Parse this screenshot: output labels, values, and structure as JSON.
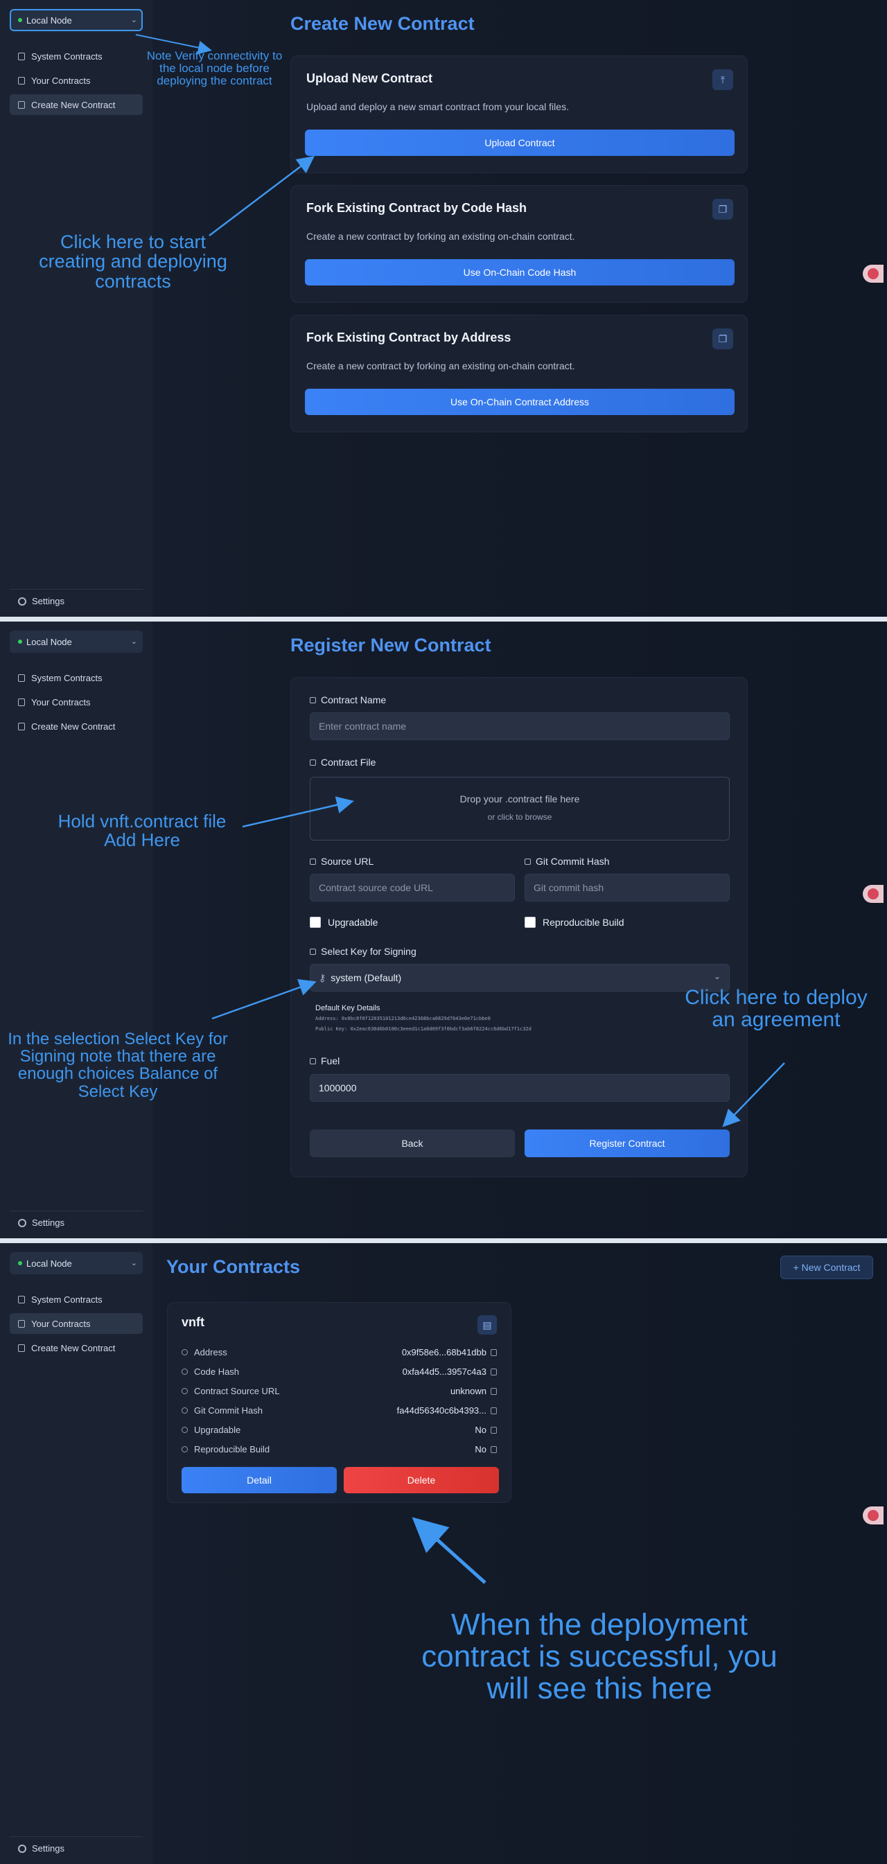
{
  "sidebar": {
    "node_label": "Local Node",
    "items": [
      "System Contracts",
      "Your Contracts",
      "Create New Contract"
    ],
    "settings_label": "Settings"
  },
  "create": {
    "title": "Create New Contract",
    "cards": [
      {
        "title": "Upload New Contract",
        "desc": "Upload and deploy a new smart contract from your local files.",
        "button": "Upload Contract",
        "icon": "upload-icon"
      },
      {
        "title": "Fork Existing Contract by Code Hash",
        "desc": "Create a new contract by forking an existing on-chain contract.",
        "button": "Use On-Chain Code Hash",
        "icon": "copy-icon"
      },
      {
        "title": "Fork Existing Contract by Address",
        "desc": "Create a new contract by forking an existing on-chain contract.",
        "button": "Use On-Chain Contract Address",
        "icon": "copy-icon"
      }
    ]
  },
  "register": {
    "title": "Register New Contract",
    "contract_name_label": "Contract Name",
    "contract_name_placeholder": "Enter contract name",
    "contract_file_label": "Contract File",
    "drop_main": "Drop your .contract file here",
    "drop_sub": "or click to browse",
    "source_url_label": "Source URL",
    "source_url_placeholder": "Contract source code URL",
    "git_label": "Git Commit Hash",
    "git_placeholder": "Git commit hash",
    "upgradable_label": "Upgradable",
    "reproducible_label": "Reproducible Build",
    "key_label": "Select Key for Signing",
    "key_value": "system (Default)",
    "key_details_title": "Default Key Details",
    "key_address": "Address: 0x0bc8f0f12035101213d6ce42368bca0829d7643e0e71cbbe0",
    "key_public": "Public Key: 0x2eac630d6b0100c3eeed1c1a0d69f3f0bdcf3ab6f8224cc6d6bd17f1c32d",
    "fuel_label": "Fuel",
    "fuel_value": "1000000",
    "back_label": "Back",
    "submit_label": "Register Contract"
  },
  "yours": {
    "title": "Your Contracts",
    "new_button": "+ New Contract",
    "contract": {
      "name": "vnft",
      "rows": [
        {
          "label": "Address",
          "value": "0x9f58e6...68b41dbb"
        },
        {
          "label": "Code Hash",
          "value": "0xfa44d5...3957c4a3"
        },
        {
          "label": "Contract Source URL",
          "value": "unknown"
        },
        {
          "label": "Git Commit Hash",
          "value": "fa44d56340c6b4393..."
        },
        {
          "label": "Upgradable",
          "value": "No"
        },
        {
          "label": "Reproducible Build",
          "value": "No"
        }
      ],
      "detail_button": "Detail",
      "delete_button": "Delete"
    }
  },
  "annotations": {
    "verify_note": "Note Verify connectivity to the local node before deploying the contract",
    "click_here": "Click here to start creating and deploying contracts",
    "hold_file": "Hold vnft.contract file Add Here",
    "select_key_note": "In the selection Select Key for Signing note that there are enough choices Balance of Select Key",
    "deploy_note": "Click here to deploy an agreement",
    "success_note": "When the deployment contract is successful, you will see this here"
  },
  "colors": {
    "accent": "#3b82f6",
    "title_blue": "#4f94f0",
    "annotation_blue": "#3f97ef",
    "danger": "#ef4444",
    "node_status": "#34d058"
  }
}
